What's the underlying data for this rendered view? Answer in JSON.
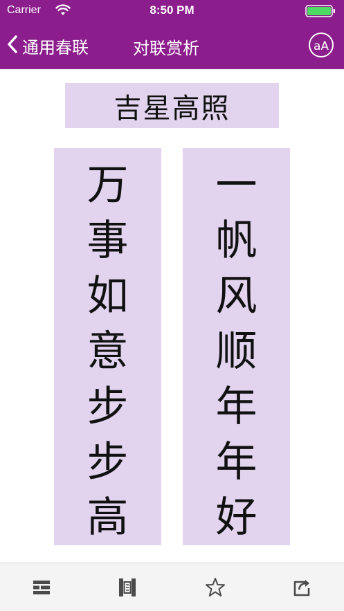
{
  "status_bar": {
    "carrier": "Carrier",
    "time": "8:50 PM"
  },
  "nav": {
    "back_label": "通用春联",
    "title": "对联赏析",
    "font_button_text": "aA"
  },
  "couplet": {
    "horizontal": "吉星高照",
    "left_scroll": [
      "万",
      "事",
      "如",
      "意",
      "步",
      "步",
      "高"
    ],
    "right_scroll": [
      "一",
      "帆",
      "风",
      "顺",
      "年",
      "年",
      "好"
    ]
  },
  "tabbar": {
    "icons": [
      "list-icon",
      "scroll-icon",
      "star-icon",
      "share-icon"
    ]
  },
  "colors": {
    "brand": "#8b1d8c",
    "scroll_bg": "#e2d3ee",
    "tabbar_bg": "#f4f4f4",
    "tab_icon": "#4a4a4a"
  }
}
